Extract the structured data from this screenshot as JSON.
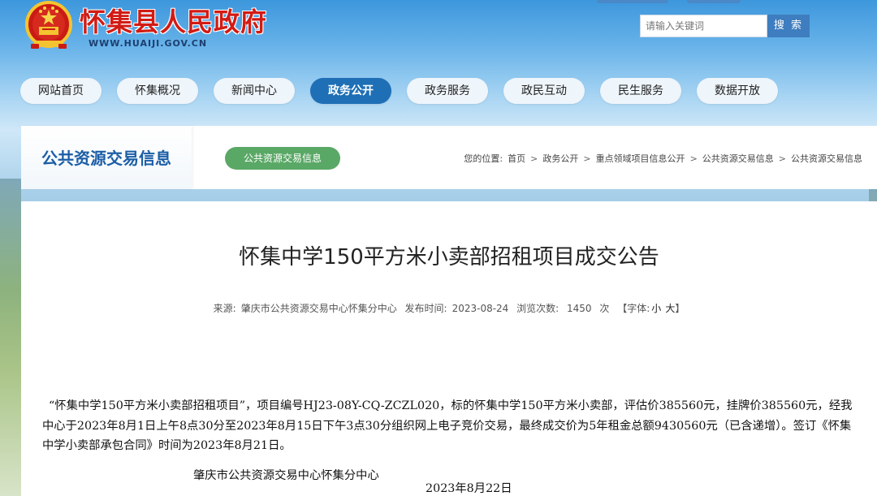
{
  "header": {
    "site_title": "怀集县人民政府",
    "site_url": "WWW.HUAIJI.GOV.CN",
    "search_placeholder": "请输入关键词",
    "search_button": "搜 索",
    "emblem_icon": "national-emblem-icon"
  },
  "nav": {
    "items": [
      {
        "label": "网站首页"
      },
      {
        "label": "怀集概况"
      },
      {
        "label": "新闻中心"
      },
      {
        "label": "政务公开"
      },
      {
        "label": "政务服务"
      },
      {
        "label": "政民互动"
      },
      {
        "label": "民生服务"
      },
      {
        "label": "数据开放"
      }
    ],
    "active_index": 3
  },
  "section": {
    "title": "公共资源交易信息",
    "tag": "公共资源交易信息",
    "breadcrumb": {
      "prefix": "您的位置:",
      "items": [
        "首页",
        "政务公开",
        "重点领域项目信息公开",
        "公共资源交易信息",
        "公共资源交易信息"
      ],
      "separator": ">"
    }
  },
  "article": {
    "title": "怀集中学150平方米小卖部招租项目成交公告",
    "meta": {
      "source_label": "来源:",
      "source": "肇庆市公共资源交易中心怀集分中心",
      "date_label": "发布时间:",
      "date": "2023-08-24",
      "views_label": "浏览次数:",
      "views": "1450",
      "views_unit": "次",
      "font_size_prefix": "【字体:",
      "font_small": "小",
      "font_large": "大",
      "font_size_suffix": "】"
    },
    "body": "“怀集中学150平方米小卖部招租项目”，项目编号HJ23-08Y-CQ-ZCZL020，标的怀集中学150平方米小卖部，评估价385560元，挂牌价385560元，经我中心于2023年8月1日上午8点30分至2023年8月15日下午3点30分组织网上电子竞价交易，最终成交价为5年租金总额9430560元（已含递增）。签订《怀集中学小卖部承包合同》时间为2023年8月21日。",
    "sign_org": "肇庆市公共资源交易中心怀集分中心",
    "sign_date": "2023年8月22日"
  },
  "colors": {
    "brand_red": "#d11b14",
    "nav_active": "#1e6fb6",
    "section_title": "#1c5ea6",
    "tag_green": "#5aa866",
    "search_button": "#3e7dbf"
  }
}
